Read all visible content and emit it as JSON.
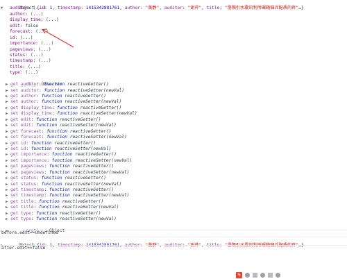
{
  "object_summary": {
    "prefix": "Object {",
    "id_key": "id",
    "id_val": "1",
    "ts_key": "timestamp",
    "ts_val": "1415342881761",
    "author_key": "author",
    "author_val": "\"黄静\"",
    "auditor_key": "auditor",
    "auditor_val": "\"谢芹\"",
    "title_key": "title",
    "title_val": "\"澄隔引水震讯利所碾鞘佃兵配质的疼\"",
    "suffix": "…}"
  },
  "properties": [
    {
      "key": "auditor",
      "value": "(...)"
    },
    {
      "key": "author",
      "value": "(...)"
    },
    {
      "key": "display_time",
      "value": "(...)"
    },
    {
      "key": "edit",
      "value": "false"
    },
    {
      "key": "forecast",
      "value": "(...)"
    },
    {
      "key": "id",
      "value": "(...)"
    },
    {
      "key": "importance",
      "value": "(...)"
    },
    {
      "key": "pageviews",
      "value": "(...)"
    },
    {
      "key": "status",
      "value": "(...)"
    },
    {
      "key": "timestamp",
      "value": "(...)"
    },
    {
      "key": "title",
      "value": "(...)"
    },
    {
      "key": "type",
      "value": "(...)"
    }
  ],
  "ob_row": {
    "key": "__ob__",
    "value": "Observer"
  },
  "accessors": [
    {
      "kind": "get",
      "key": "auditor",
      "fn": "reactiveGetter()"
    },
    {
      "kind": "set",
      "key": "auditor",
      "fn": "reactiveSetter(newVal)"
    },
    {
      "kind": "get",
      "key": "author",
      "fn": "reactiveGetter()"
    },
    {
      "kind": "set",
      "key": "author",
      "fn": "reactiveSetter(newVal)"
    },
    {
      "kind": "get",
      "key": "display_time",
      "fn": "reactiveGetter()"
    },
    {
      "kind": "set",
      "key": "display_time",
      "fn": "reactiveSetter(newVal)"
    },
    {
      "kind": "get",
      "key": "edit",
      "fn": "reactiveGetter()"
    },
    {
      "kind": "set",
      "key": "edit",
      "fn": "reactiveSetter(newVal)"
    },
    {
      "kind": "get",
      "key": "forecast",
      "fn": "reactiveGetter()"
    },
    {
      "kind": "set",
      "key": "forecast",
      "fn": "reactiveSetter(newVal)"
    },
    {
      "kind": "get",
      "key": "id",
      "fn": "reactiveGetter()"
    },
    {
      "kind": "set",
      "key": "id",
      "fn": "reactiveSetter(newVal)"
    },
    {
      "kind": "get",
      "key": "importance",
      "fn": "reactiveGetter()"
    },
    {
      "kind": "set",
      "key": "importance",
      "fn": "reactiveSetter(newVal)"
    },
    {
      "kind": "get",
      "key": "pageviews",
      "fn": "reactiveGetter()"
    },
    {
      "kind": "set",
      "key": "pageviews",
      "fn": "reactiveSetter(newVal)"
    },
    {
      "kind": "get",
      "key": "status",
      "fn": "reactiveGetter()"
    },
    {
      "kind": "set",
      "key": "status",
      "fn": "reactiveSetter(newVal)"
    },
    {
      "kind": "get",
      "key": "timestamp",
      "fn": "reactiveGetter()"
    },
    {
      "kind": "set",
      "key": "timestamp",
      "fn": "reactiveSetter(newVal)"
    },
    {
      "kind": "get",
      "key": "title",
      "fn": "reactiveGetter()"
    },
    {
      "kind": "set",
      "key": "title",
      "fn": "reactiveSetter(newVal)"
    },
    {
      "kind": "get",
      "key": "type",
      "fn": "reactiveGetter()"
    },
    {
      "kind": "set",
      "key": "type",
      "fn": "reactiveSetter(newVal)"
    }
  ],
  "function_keyword": "function",
  "proto_row": {
    "key": "__proto__",
    "value": "Object"
  },
  "log_before": "before.edit==undefined",
  "log_after": "after.edit==false",
  "colors": {
    "arrow": "#d9373a",
    "keyword": "#0d22aa",
    "key": "#881391",
    "string": "#c41a16",
    "number": "#1c00cf"
  },
  "taskbar": {
    "ime_label": "S",
    "icons": [
      "ime-icon",
      "punctuation-icon",
      "keyboard-icon",
      "emoji-icon",
      "clipboard-icon",
      "settings-icon"
    ]
  }
}
